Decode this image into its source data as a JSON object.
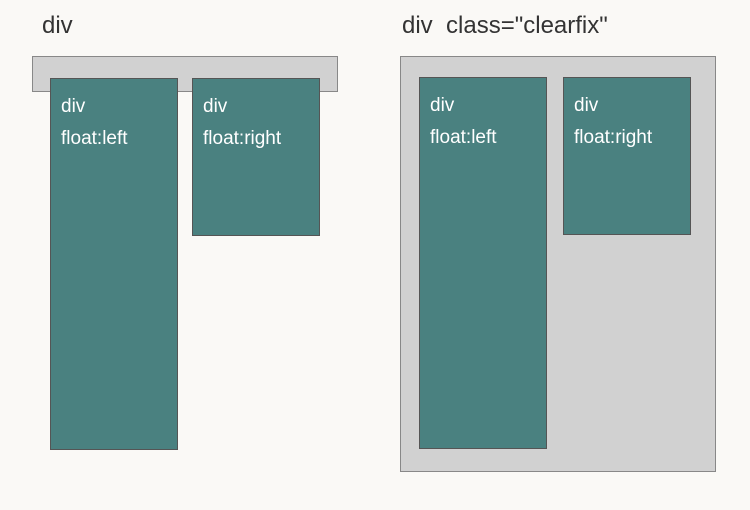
{
  "left": {
    "title": "div",
    "boxA": {
      "line1": "div",
      "line2": "float:left"
    },
    "boxB": {
      "line1": "div",
      "line2": "float:right"
    }
  },
  "right": {
    "title_part1": "div",
    "title_part2": "class=\"clearfix\"",
    "boxA": {
      "line1": "div",
      "line2": "float:left"
    },
    "boxB": {
      "line1": "div",
      "line2": "float:right"
    }
  }
}
